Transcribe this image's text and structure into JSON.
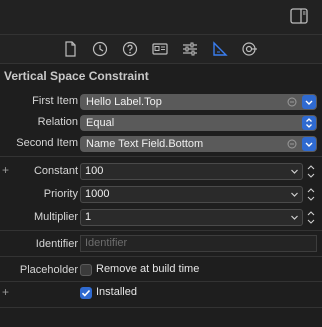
{
  "section_title": "Vertical Space Constraint",
  "rows": {
    "first_item": {
      "label": "First Item",
      "value": "Hello Label.Top"
    },
    "relation": {
      "label": "Relation",
      "value": "Equal"
    },
    "second_item": {
      "label": "Second Item",
      "value": "Name Text Field.Bottom"
    },
    "constant": {
      "label": "Constant",
      "value": "100"
    },
    "priority": {
      "label": "Priority",
      "value": "1000"
    },
    "multiplier": {
      "label": "Multiplier",
      "value": "1"
    },
    "identifier": {
      "label": "Identifier",
      "placeholder": "Identifier"
    },
    "placeholder": {
      "label": "Placeholder",
      "checkbox_label": "Remove at build time",
      "checked": false
    },
    "installed": {
      "checkbox_label": "Installed",
      "checked": true
    }
  },
  "tabs": [
    "file-inspector-icon",
    "history-inspector-icon",
    "quick-help-icon",
    "identity-inspector-icon",
    "attributes-inspector-icon",
    "size-inspector-icon",
    "connections-inspector-icon"
  ],
  "colors": {
    "accent": "#2f6ad0",
    "background": "#1e1e1e"
  }
}
